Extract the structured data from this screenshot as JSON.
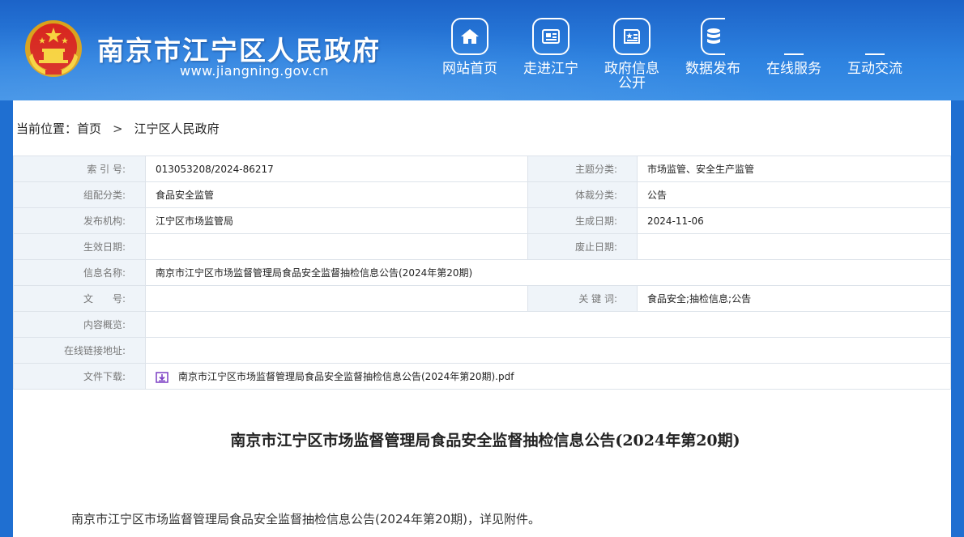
{
  "header": {
    "site_title": "南京市江宁区人民政府",
    "site_url": "www.jiangning.gov.cn",
    "nav": [
      {
        "label": "网站首页",
        "icon": "home-icon"
      },
      {
        "label": "走进江宁",
        "icon": "newspaper-icon"
      },
      {
        "label": "政府信息公开",
        "icon": "document-star-icon"
      },
      {
        "label": "数据发布",
        "icon": "database-icon"
      },
      {
        "label": "在线服务",
        "icon": ""
      },
      {
        "label": "互动交流",
        "icon": ""
      }
    ]
  },
  "breadcrumb": {
    "prefix": "当前位置：",
    "home": "首页",
    "separator": ">",
    "current": "江宁区人民政府"
  },
  "meta": {
    "index_label": "索 引 号:",
    "index_value": "013053208/2024-86217",
    "topic_label": "主题分类:",
    "topic_value": "市场监管、安全生产监管",
    "group_label": "组配分类:",
    "group_value": "食品安全监管",
    "genre_label": "体裁分类:",
    "genre_value": "公告",
    "publisher_label": "发布机构:",
    "publisher_value": "江宁区市场监管局",
    "created_label": "生成日期:",
    "created_value": "2024-11-06",
    "effective_label": "生效日期:",
    "effective_value": "",
    "abolish_label": "废止日期:",
    "abolish_value": "",
    "name_label": "信息名称:",
    "name_value": "南京市江宁区市场监督管理局食品安全监督抽检信息公告(2024年第20期)",
    "docno_label": "文　　号:",
    "docno_value": "",
    "keywords_label": "关 键 词:",
    "keywords_value": "食品安全;抽检信息;公告",
    "summary_label": "内容概览:",
    "summary_value": "",
    "link_label": "在线链接地址:",
    "link_value": "",
    "download_label": "文件下载:",
    "download_file": "南京市江宁区市场监督管理局食品安全监督抽检信息公告(2024年第20期).pdf"
  },
  "article": {
    "title": "南京市江宁区市场监督管理局食品安全监督抽检信息公告(2024年第20期)",
    "body": "南京市江宁区市场监督管理局食品安全监督抽检信息公告(2024年第20期)，详见附件。"
  },
  "colors": {
    "header_blue": "#2d82e0",
    "label_bg": "#eff4f9",
    "download_icon": "#7b3fc4"
  }
}
